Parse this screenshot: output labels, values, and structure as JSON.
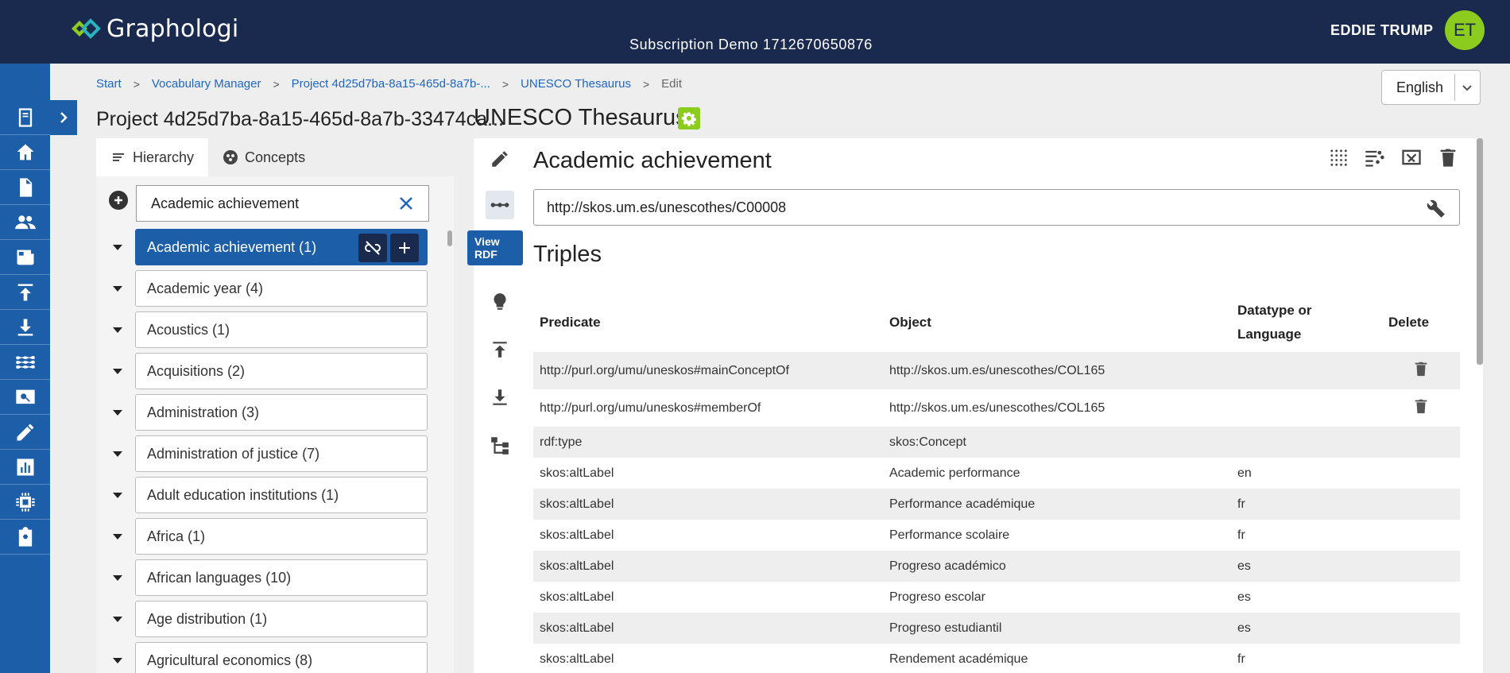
{
  "header": {
    "logo_text": "Graphologi",
    "subscription": "Subscription Demo 1712670650876",
    "user_name": "EDDIE TRUMP",
    "user_initials": "ET"
  },
  "nav": {
    "items": [
      "book-icon",
      "home-icon",
      "document-icon",
      "people-icon",
      "newspaper-icon",
      "upload-icon",
      "download-icon",
      "waves-icon",
      "search-screen-icon",
      "pencil-icon",
      "chart-icon",
      "chip-icon",
      "assignment-icon"
    ]
  },
  "breadcrumb": {
    "items": [
      "Start",
      "Vocabulary Manager",
      "Project 4d25d7ba-8a15-465d-8a7b-...",
      "UNESCO Thesaurus"
    ],
    "current": "Edit"
  },
  "language": {
    "selected": "English"
  },
  "project_title": "Project 4d25d7ba-8a15-465d-8a7b-33474ca...",
  "vocab_title": "UNESCO Thesaurus",
  "left_panel": {
    "tabs": {
      "hierarchy": "Hierarchy",
      "concepts": "Concepts"
    },
    "search_value": "Academic achievement",
    "tree": [
      {
        "label": "Academic achievement (1)",
        "selected": true
      },
      {
        "label": "Academic year (4)"
      },
      {
        "label": "Acoustics (1)"
      },
      {
        "label": "Acquisitions (2)"
      },
      {
        "label": "Administration (3)"
      },
      {
        "label": "Administration of justice (7)"
      },
      {
        "label": "Adult education institutions (1)"
      },
      {
        "label": "Africa (1)"
      },
      {
        "label": "African languages (10)"
      },
      {
        "label": "Age distribution (1)"
      },
      {
        "label": "Agricultural economics (8)"
      }
    ]
  },
  "right_panel": {
    "tooltip": "View RDF",
    "concept_title": "Academic achievement",
    "uri": "http://skos.um.es/unescothes/C00008",
    "triples_title": "Triples",
    "columns": {
      "predicate": "Predicate",
      "object": "Object",
      "datatype_line1": "Datatype or",
      "datatype_line2": "Language",
      "delete": "Delete"
    },
    "rows": [
      {
        "predicate": "http://purl.org/umu/uneskos#mainConceptOf",
        "object": "http://skos.um.es/unescothes/COL165",
        "lang": ""
      },
      {
        "predicate": "http://purl.org/umu/uneskos#memberOf",
        "object": "http://skos.um.es/unescothes/COL165",
        "lang": ""
      },
      {
        "predicate": "rdf:type",
        "object": "skos:Concept",
        "lang": ""
      },
      {
        "predicate": "skos:altLabel",
        "object": "Academic performance",
        "lang": "en"
      },
      {
        "predicate": "skos:altLabel",
        "object": "Performance académique",
        "lang": "fr"
      },
      {
        "predicate": "skos:altLabel",
        "object": "Performance scolaire",
        "lang": "fr"
      },
      {
        "predicate": "skos:altLabel",
        "object": "Progreso académico",
        "lang": "es"
      },
      {
        "predicate": "skos:altLabel",
        "object": "Progreso escolar",
        "lang": "es"
      },
      {
        "predicate": "skos:altLabel",
        "object": "Progreso estudiantil",
        "lang": "es"
      },
      {
        "predicate": "skos:altLabel",
        "object": "Rendement académique",
        "lang": "fr"
      }
    ]
  },
  "colors": {
    "header_bg": "#1a2a4f",
    "nav_bg": "#1c5ea8",
    "accent_green": "#8ccc1e",
    "link": "#1f66c2"
  }
}
